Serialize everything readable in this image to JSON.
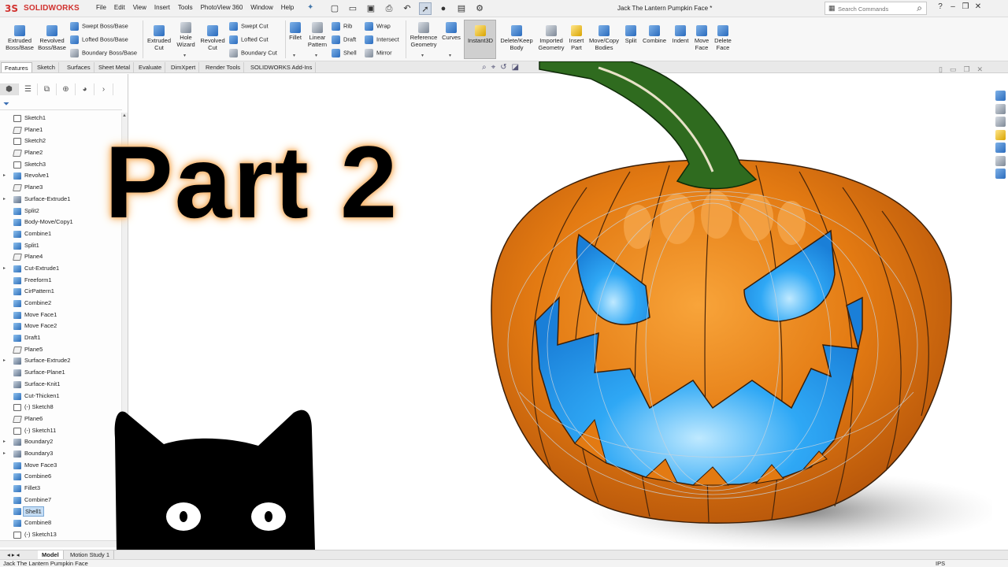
{
  "app": {
    "logo_mark": "3S",
    "logo_text": "SOLIDWORKS",
    "document_title": "Jack The Lantern Pumpkin Face *",
    "status_doc_name": "Jack The Lantern Pumpkin Face",
    "units": "IPS"
  },
  "menu": [
    "File",
    "Edit",
    "View",
    "Insert",
    "Tools",
    "PhotoView 360",
    "Window",
    "Help"
  ],
  "search": {
    "placeholder": "Search Commands"
  },
  "ribbon": {
    "extruded_boss": "Extruded Boss/Base",
    "revolved_boss": "Revolved Boss/Base",
    "swept_boss": "Swept Boss/Base",
    "lofted_boss": "Lofted Boss/Base",
    "boundary_boss": "Boundary Boss/Base",
    "extruded_cut": "Extruded Cut",
    "hole_wizard": "Hole Wizard",
    "revolved_cut": "Revolved Cut",
    "swept_cut": "Swept Cut",
    "lofted_cut": "Lofted Cut",
    "boundary_cut": "Boundary Cut",
    "fillet": "Fillet",
    "linear_pattern": "Linear Pattern",
    "rib": "Rib",
    "draft": "Draft",
    "shell": "Shell",
    "wrap": "Wrap",
    "intersect": "Intersect",
    "mirror": "Mirror",
    "reference_geometry": "Reference Geometry",
    "curves": "Curves",
    "instant3d": "Instant3D",
    "delete_keep_body": "Delete/Keep Body",
    "imported_geometry": "Imported Geometry",
    "insert_part": "Insert Part",
    "move_copy_bodies": "Move/Copy Bodies",
    "split": "Split",
    "combine": "Combine",
    "indent": "Indent",
    "move_face": "Move Face",
    "delete_face": "Delete Face"
  },
  "tabs": [
    "Features",
    "Sketch",
    "Surfaces",
    "Sheet Metal",
    "Evaluate",
    "DimXpert",
    "Render Tools",
    "SOLIDWORKS Add-Ins"
  ],
  "tree": [
    {
      "label": "Sketch1",
      "type": "sketch",
      "expandable": false
    },
    {
      "label": "Plane1",
      "type": "plane",
      "expandable": false
    },
    {
      "label": "Sketch2",
      "type": "sketch",
      "expandable": false
    },
    {
      "label": "Plane2",
      "type": "plane",
      "expandable": false
    },
    {
      "label": "Sketch3",
      "type": "sketch",
      "expandable": false
    },
    {
      "label": "Revolve1",
      "type": "feat",
      "expandable": true
    },
    {
      "label": "Plane3",
      "type": "plane",
      "expandable": false
    },
    {
      "label": "Surface-Extrude1",
      "type": "surf",
      "expandable": true
    },
    {
      "label": "Split2",
      "type": "feat",
      "expandable": false
    },
    {
      "label": "Body-Move/Copy1",
      "type": "feat",
      "expandable": false
    },
    {
      "label": "Combine1",
      "type": "feat",
      "expandable": false
    },
    {
      "label": "Split1",
      "type": "feat",
      "expandable": false
    },
    {
      "label": "Plane4",
      "type": "plane",
      "expandable": false
    },
    {
      "label": "Cut-Extrude1",
      "type": "feat",
      "expandable": true
    },
    {
      "label": "Freeform1",
      "type": "feat",
      "expandable": false
    },
    {
      "label": "CirPattern1",
      "type": "feat",
      "expandable": false
    },
    {
      "label": "Combine2",
      "type": "feat",
      "expandable": false
    },
    {
      "label": "Move Face1",
      "type": "feat",
      "expandable": false
    },
    {
      "label": "Move Face2",
      "type": "feat",
      "expandable": false
    },
    {
      "label": "Draft1",
      "type": "feat",
      "expandable": false
    },
    {
      "label": "Plane5",
      "type": "plane",
      "expandable": false
    },
    {
      "label": "Surface-Extrude2",
      "type": "surf",
      "expandable": true
    },
    {
      "label": "Surface-Plane1",
      "type": "surf",
      "expandable": false
    },
    {
      "label": "Surface-Knit1",
      "type": "surf",
      "expandable": false
    },
    {
      "label": "Cut-Thicken1",
      "type": "feat",
      "expandable": false
    },
    {
      "label": "(-) Sketch8",
      "type": "sketch",
      "expandable": false
    },
    {
      "label": "Plane6",
      "type": "plane",
      "expandable": false
    },
    {
      "label": "(-) Sketch11",
      "type": "sketch",
      "expandable": false
    },
    {
      "label": "Boundary2",
      "type": "surf",
      "expandable": true
    },
    {
      "label": "Boundary3",
      "type": "surf",
      "expandable": true
    },
    {
      "label": "Move Face3",
      "type": "feat",
      "expandable": false
    },
    {
      "label": "Combine6",
      "type": "feat",
      "expandable": false
    },
    {
      "label": "Fillet3",
      "type": "feat",
      "expandable": false
    },
    {
      "label": "Combine7",
      "type": "feat",
      "expandable": false
    },
    {
      "label": "Shell1",
      "type": "feat",
      "expandable": false,
      "selected": true
    },
    {
      "label": "Combine8",
      "type": "feat",
      "expandable": false
    },
    {
      "label": "(-) Sketch13",
      "type": "sketch",
      "expandable": false
    }
  ],
  "model_tabs": [
    "Model",
    "Motion Study 1"
  ],
  "overlay": {
    "title": "Part 2"
  },
  "colors": {
    "brand_red": "#d1312e",
    "pumpkin_orange": "#e37a12",
    "stem_green": "#2f6b1f",
    "glow_blue": "#1e9bf0",
    "selection_blue": "#c6def5"
  }
}
